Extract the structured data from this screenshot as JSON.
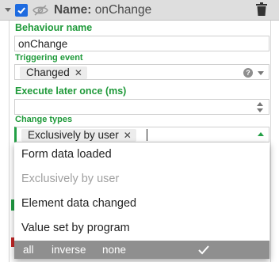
{
  "header": {
    "name_label": "Name:",
    "name_value": "onChange"
  },
  "fields": {
    "behaviour_name": {
      "label": "Behaviour name",
      "value": "onChange"
    },
    "triggering_event": {
      "label": "Triggering event",
      "tags": [
        "Changed"
      ]
    },
    "execute_later": {
      "label": "Execute later once (ms)",
      "value": ""
    },
    "change_types": {
      "label": "Change types",
      "tags": [
        "Exclusively by user"
      ]
    }
  },
  "dropdown": {
    "items": [
      {
        "label": "Form data loaded",
        "disabled": false
      },
      {
        "label": "Exclusively by user",
        "disabled": true
      },
      {
        "label": "Element data changed",
        "disabled": false
      },
      {
        "label": "Value set by program",
        "disabled": false
      }
    ],
    "footer": {
      "all": "all",
      "inverse": "inverse",
      "none": "none"
    }
  },
  "icons": {
    "collapse": "chevron-down-icon",
    "enabled": "checkbox-checked-icon",
    "visibility": "eye-off-icon",
    "delete": "trash-icon",
    "help": "help-icon",
    "remove_tag": "close-icon",
    "confirm": "check-icon"
  },
  "colors": {
    "accent_green": "#23a046",
    "checkbox_blue": "#1e6be0",
    "header_bg": "#dedede",
    "menu_footer_bg": "#8f8f8f"
  }
}
